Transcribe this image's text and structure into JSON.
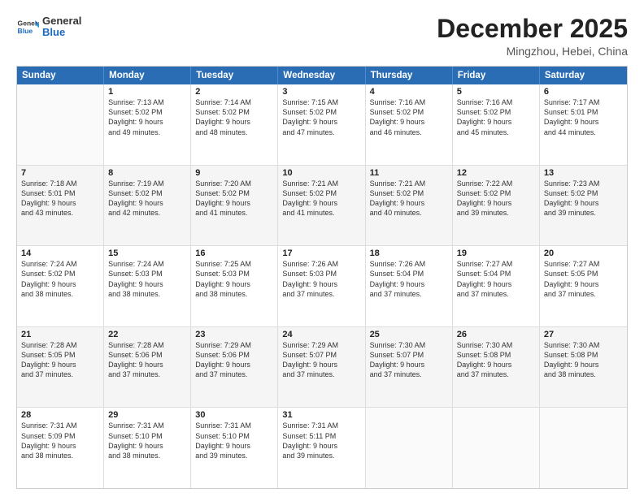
{
  "header": {
    "logo_general": "General",
    "logo_blue": "Blue",
    "month_title": "December 2025",
    "location": "Mingzhou, Hebei, China"
  },
  "days_of_week": [
    "Sunday",
    "Monday",
    "Tuesday",
    "Wednesday",
    "Thursday",
    "Friday",
    "Saturday"
  ],
  "weeks": [
    [
      {
        "day": "",
        "empty": true
      },
      {
        "day": "1",
        "sunrise": "Sunrise: 7:13 AM",
        "sunset": "Sunset: 5:02 PM",
        "daylight": "Daylight: 9 hours",
        "daylight2": "and 49 minutes."
      },
      {
        "day": "2",
        "sunrise": "Sunrise: 7:14 AM",
        "sunset": "Sunset: 5:02 PM",
        "daylight": "Daylight: 9 hours",
        "daylight2": "and 48 minutes."
      },
      {
        "day": "3",
        "sunrise": "Sunrise: 7:15 AM",
        "sunset": "Sunset: 5:02 PM",
        "daylight": "Daylight: 9 hours",
        "daylight2": "and 47 minutes."
      },
      {
        "day": "4",
        "sunrise": "Sunrise: 7:16 AM",
        "sunset": "Sunset: 5:02 PM",
        "daylight": "Daylight: 9 hours",
        "daylight2": "and 46 minutes."
      },
      {
        "day": "5",
        "sunrise": "Sunrise: 7:16 AM",
        "sunset": "Sunset: 5:02 PM",
        "daylight": "Daylight: 9 hours",
        "daylight2": "and 45 minutes."
      },
      {
        "day": "6",
        "sunrise": "Sunrise: 7:17 AM",
        "sunset": "Sunset: 5:01 PM",
        "daylight": "Daylight: 9 hours",
        "daylight2": "and 44 minutes."
      }
    ],
    [
      {
        "day": "7",
        "sunrise": "Sunrise: 7:18 AM",
        "sunset": "Sunset: 5:01 PM",
        "daylight": "Daylight: 9 hours",
        "daylight2": "and 43 minutes."
      },
      {
        "day": "8",
        "sunrise": "Sunrise: 7:19 AM",
        "sunset": "Sunset: 5:02 PM",
        "daylight": "Daylight: 9 hours",
        "daylight2": "and 42 minutes."
      },
      {
        "day": "9",
        "sunrise": "Sunrise: 7:20 AM",
        "sunset": "Sunset: 5:02 PM",
        "daylight": "Daylight: 9 hours",
        "daylight2": "and 41 minutes."
      },
      {
        "day": "10",
        "sunrise": "Sunrise: 7:21 AM",
        "sunset": "Sunset: 5:02 PM",
        "daylight": "Daylight: 9 hours",
        "daylight2": "and 41 minutes."
      },
      {
        "day": "11",
        "sunrise": "Sunrise: 7:21 AM",
        "sunset": "Sunset: 5:02 PM",
        "daylight": "Daylight: 9 hours",
        "daylight2": "and 40 minutes."
      },
      {
        "day": "12",
        "sunrise": "Sunrise: 7:22 AM",
        "sunset": "Sunset: 5:02 PM",
        "daylight": "Daylight: 9 hours",
        "daylight2": "and 39 minutes."
      },
      {
        "day": "13",
        "sunrise": "Sunrise: 7:23 AM",
        "sunset": "Sunset: 5:02 PM",
        "daylight": "Daylight: 9 hours",
        "daylight2": "and 39 minutes."
      }
    ],
    [
      {
        "day": "14",
        "sunrise": "Sunrise: 7:24 AM",
        "sunset": "Sunset: 5:02 PM",
        "daylight": "Daylight: 9 hours",
        "daylight2": "and 38 minutes."
      },
      {
        "day": "15",
        "sunrise": "Sunrise: 7:24 AM",
        "sunset": "Sunset: 5:03 PM",
        "daylight": "Daylight: 9 hours",
        "daylight2": "and 38 minutes."
      },
      {
        "day": "16",
        "sunrise": "Sunrise: 7:25 AM",
        "sunset": "Sunset: 5:03 PM",
        "daylight": "Daylight: 9 hours",
        "daylight2": "and 38 minutes."
      },
      {
        "day": "17",
        "sunrise": "Sunrise: 7:26 AM",
        "sunset": "Sunset: 5:03 PM",
        "daylight": "Daylight: 9 hours",
        "daylight2": "and 37 minutes."
      },
      {
        "day": "18",
        "sunrise": "Sunrise: 7:26 AM",
        "sunset": "Sunset: 5:04 PM",
        "daylight": "Daylight: 9 hours",
        "daylight2": "and 37 minutes."
      },
      {
        "day": "19",
        "sunrise": "Sunrise: 7:27 AM",
        "sunset": "Sunset: 5:04 PM",
        "daylight": "Daylight: 9 hours",
        "daylight2": "and 37 minutes."
      },
      {
        "day": "20",
        "sunrise": "Sunrise: 7:27 AM",
        "sunset": "Sunset: 5:05 PM",
        "daylight": "Daylight: 9 hours",
        "daylight2": "and 37 minutes."
      }
    ],
    [
      {
        "day": "21",
        "sunrise": "Sunrise: 7:28 AM",
        "sunset": "Sunset: 5:05 PM",
        "daylight": "Daylight: 9 hours",
        "daylight2": "and 37 minutes."
      },
      {
        "day": "22",
        "sunrise": "Sunrise: 7:28 AM",
        "sunset": "Sunset: 5:06 PM",
        "daylight": "Daylight: 9 hours",
        "daylight2": "and 37 minutes."
      },
      {
        "day": "23",
        "sunrise": "Sunrise: 7:29 AM",
        "sunset": "Sunset: 5:06 PM",
        "daylight": "Daylight: 9 hours",
        "daylight2": "and 37 minutes."
      },
      {
        "day": "24",
        "sunrise": "Sunrise: 7:29 AM",
        "sunset": "Sunset: 5:07 PM",
        "daylight": "Daylight: 9 hours",
        "daylight2": "and 37 minutes."
      },
      {
        "day": "25",
        "sunrise": "Sunrise: 7:30 AM",
        "sunset": "Sunset: 5:07 PM",
        "daylight": "Daylight: 9 hours",
        "daylight2": "and 37 minutes."
      },
      {
        "day": "26",
        "sunrise": "Sunrise: 7:30 AM",
        "sunset": "Sunset: 5:08 PM",
        "daylight": "Daylight: 9 hours",
        "daylight2": "and 37 minutes."
      },
      {
        "day": "27",
        "sunrise": "Sunrise: 7:30 AM",
        "sunset": "Sunset: 5:08 PM",
        "daylight": "Daylight: 9 hours",
        "daylight2": "and 38 minutes."
      }
    ],
    [
      {
        "day": "28",
        "sunrise": "Sunrise: 7:31 AM",
        "sunset": "Sunset: 5:09 PM",
        "daylight": "Daylight: 9 hours",
        "daylight2": "and 38 minutes."
      },
      {
        "day": "29",
        "sunrise": "Sunrise: 7:31 AM",
        "sunset": "Sunset: 5:10 PM",
        "daylight": "Daylight: 9 hours",
        "daylight2": "and 38 minutes."
      },
      {
        "day": "30",
        "sunrise": "Sunrise: 7:31 AM",
        "sunset": "Sunset: 5:10 PM",
        "daylight": "Daylight: 9 hours",
        "daylight2": "and 39 minutes."
      },
      {
        "day": "31",
        "sunrise": "Sunrise: 7:31 AM",
        "sunset": "Sunset: 5:11 PM",
        "daylight": "Daylight: 9 hours",
        "daylight2": "and 39 minutes."
      },
      {
        "day": "",
        "empty": true
      },
      {
        "day": "",
        "empty": true
      },
      {
        "day": "",
        "empty": true
      }
    ]
  ]
}
